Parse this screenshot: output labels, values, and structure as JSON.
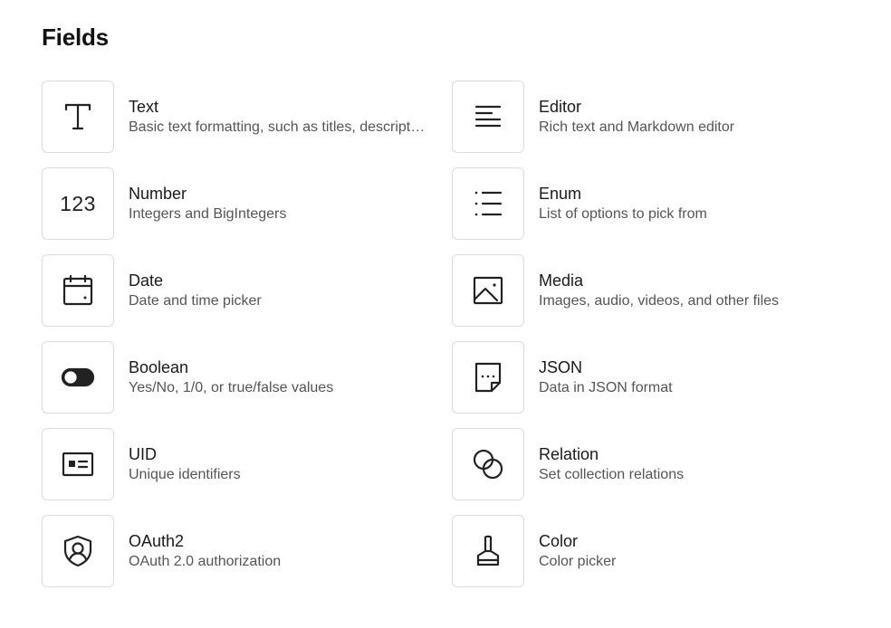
{
  "header": {
    "title": "Fields"
  },
  "fields": [
    {
      "name": "Text",
      "description": "Basic text formatting, such as titles, descriptions",
      "icon": "text-icon"
    },
    {
      "name": "Editor",
      "description": "Rich text and Markdown editor",
      "icon": "align-left-icon"
    },
    {
      "name": "Number",
      "description": "Integers and BigIntegers",
      "icon": "number-icon",
      "icon_text": "123"
    },
    {
      "name": "Enum",
      "description": "List of options to pick from",
      "icon": "list-icon"
    },
    {
      "name": "Date",
      "description": "Date and time picker",
      "icon": "calendar-icon"
    },
    {
      "name": "Media",
      "description": "Images, audio, videos, and other files",
      "icon": "image-icon"
    },
    {
      "name": "Boolean",
      "description": "Yes/No, 1/0, or true/false values",
      "icon": "toggle-icon"
    },
    {
      "name": "JSON",
      "description": "Data in JSON format",
      "icon": "note-icon"
    },
    {
      "name": "UID",
      "description": "Unique identifiers",
      "icon": "id-card-icon"
    },
    {
      "name": "Relation",
      "description": "Set collection relations",
      "icon": "link-icon"
    },
    {
      "name": "OAuth2",
      "description": "OAuth 2.0 authorization",
      "icon": "shield-user-icon"
    },
    {
      "name": "Color",
      "description": "Color picker",
      "icon": "paint-brush-icon"
    }
  ]
}
